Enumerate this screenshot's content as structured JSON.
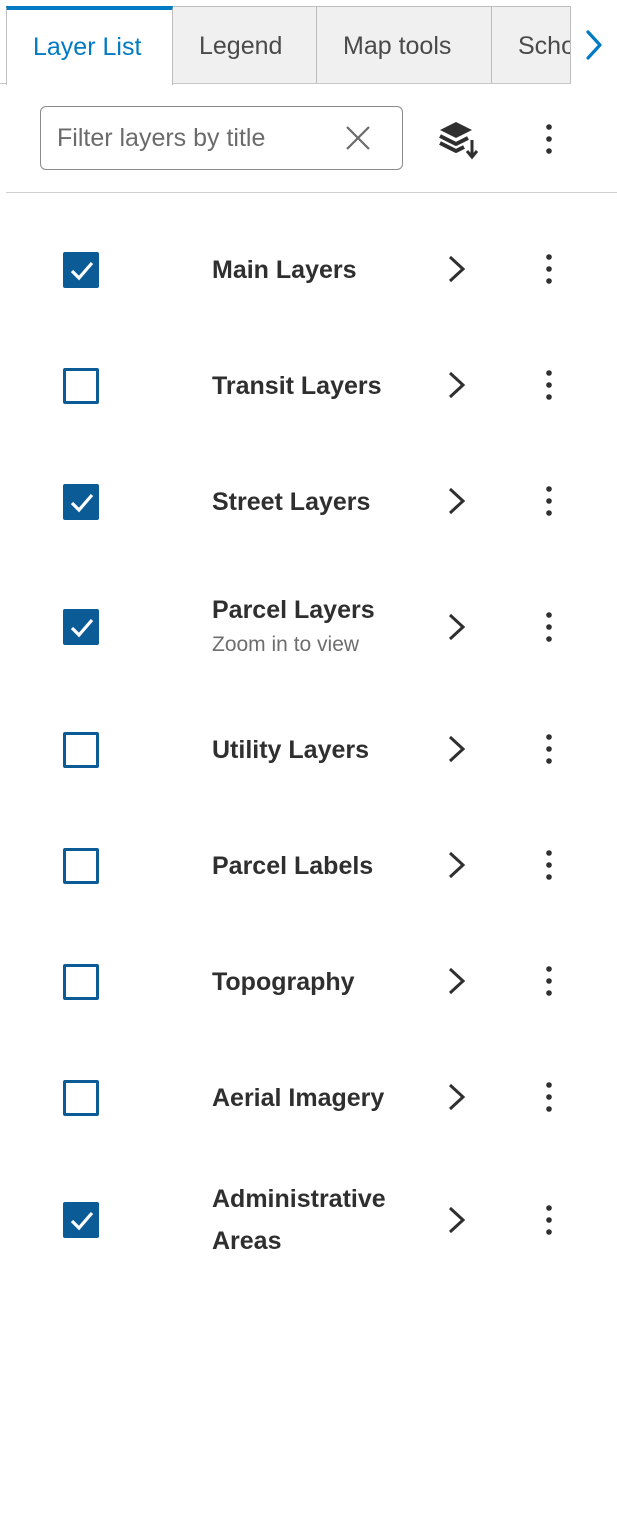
{
  "tabs": [
    {
      "label": "Layer List",
      "active": true
    },
    {
      "label": "Legend",
      "active": false
    },
    {
      "label": "Map tools",
      "active": false
    },
    {
      "label": "Scho",
      "active": false
    }
  ],
  "tab_scroll_icon": "chevron-right-icon",
  "filter": {
    "placeholder": "Filter layers by title",
    "value": "",
    "clear_icon": "close-icon"
  },
  "toolbar": {
    "sort_icon": "layers-sort-icon",
    "more_icon": "kebab-menu-icon"
  },
  "accent_color": "#007ac2",
  "checkbox_color": "#0b5c96",
  "layers": [
    {
      "title": "Main Layers",
      "checked": true,
      "subtitle": ""
    },
    {
      "title": "Transit Layers",
      "checked": false,
      "subtitle": ""
    },
    {
      "title": "Street Layers",
      "checked": true,
      "subtitle": ""
    },
    {
      "title": "Parcel Layers",
      "checked": true,
      "subtitle": "Zoom in to view"
    },
    {
      "title": "Utility Layers",
      "checked": false,
      "subtitle": ""
    },
    {
      "title": "Parcel Labels",
      "checked": false,
      "subtitle": ""
    },
    {
      "title": "Topography",
      "checked": false,
      "subtitle": ""
    },
    {
      "title": "Aerial Imagery",
      "checked": false,
      "subtitle": ""
    },
    {
      "title_lines": [
        "Administrative",
        "Areas"
      ],
      "checked": true,
      "subtitle": ""
    }
  ]
}
